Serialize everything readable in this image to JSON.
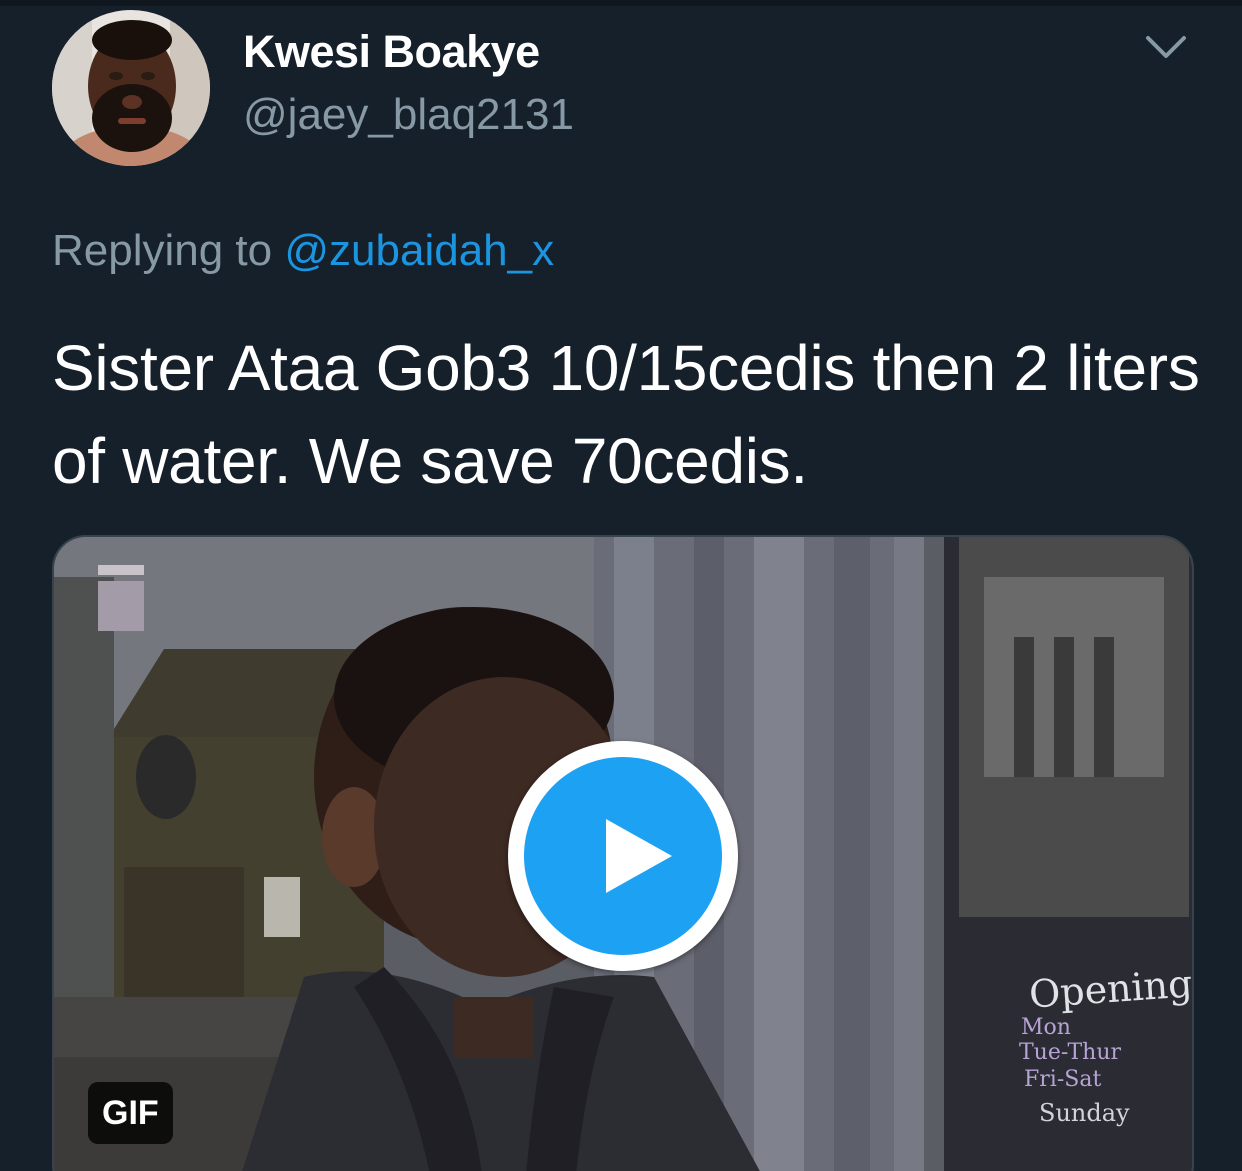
{
  "tweet": {
    "display_name": "Kwesi Boakye",
    "handle": "@jaey_blaq2131",
    "reply_prefix": "Replying to",
    "reply_to": "@zubaidah_x",
    "text": "Sister Ataa Gob3 10/15cedis then 2 liters of water. We save 70cedis.",
    "media": {
      "badge": "GIF",
      "sign_title": "Opening",
      "sign_lines": [
        "Mon",
        "Tue-Thur",
        "Fri-Sat",
        "Sunday"
      ]
    }
  },
  "icons": {
    "menu": "chevron-down-icon",
    "play": "play-icon",
    "avatar": "avatar"
  },
  "colors": {
    "background": "#15202b",
    "primary_text": "#ffffff",
    "secondary_text": "#8899a6",
    "link": "#1b95e0",
    "play_button": "#1da1f2"
  }
}
